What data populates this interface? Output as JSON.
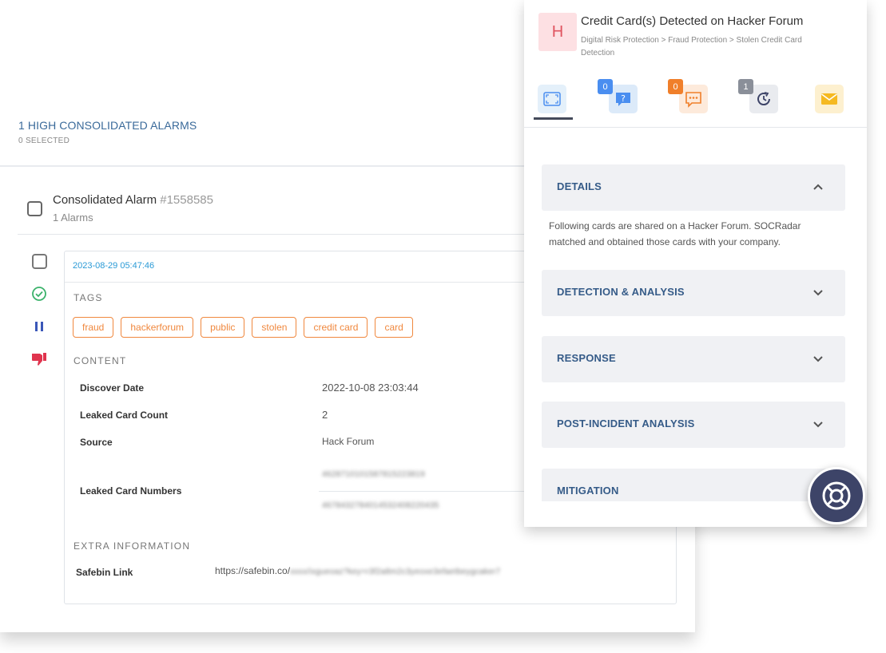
{
  "alarms": {
    "title": "1 HIGH CONSOLIDATED ALARMS",
    "selected": "0 SELECTED"
  },
  "consolidated": {
    "title": "Consolidated Alarm ",
    "id": "#1558585",
    "count": "1 Alarms"
  },
  "alarm_detail": {
    "date": "2023-08-29 05:47:46",
    "tags_label": "TAGS",
    "tags": [
      "fraud",
      "hackerforum",
      "public",
      "stolen",
      "credit card",
      "card"
    ],
    "content_label": "CONTENT",
    "fields": {
      "discover_date": {
        "label": "Discover Date",
        "value": "2022-10-08 23:03:44"
      },
      "leaked_card_count": {
        "label": "Leaked Card Count",
        "value": "2"
      },
      "source": {
        "label": "Source",
        "value": "Hack Forum"
      },
      "leaked_card_numbers": {
        "label": "Leaked Card Numbers",
        "values": [
          "4628710101587815223819",
          "4678432784014532408220435"
        ]
      }
    },
    "extra_label": "EXTRA INFORMATION",
    "safebin": {
      "label": "Safebin Link",
      "prefix": "https://safebin.co/",
      "blurred": "xxxx/ixgueoaz?key=r3f2a8m2c3yeoxe3efaetbeygcaker7"
    }
  },
  "panel": {
    "avatar_letter": "H",
    "title": "Credit Card(s) Detected on Hacker Forum",
    "breadcrumb": "Digital Risk Protection > Fraud Protection > Stolen Credit Card Detection",
    "tabs": [
      {
        "icon": "expand-icon",
        "badge": ""
      },
      {
        "icon": "question-icon",
        "badge": "0",
        "color": "#4a8ef0"
      },
      {
        "icon": "comment-icon",
        "badge": "0",
        "color": "#f07f2a"
      },
      {
        "icon": "history-icon",
        "badge": "1",
        "color": "#8a8f99"
      },
      {
        "icon": "mail-icon",
        "badge": ""
      }
    ],
    "sections": {
      "details": "DETAILS",
      "details_text": "Following cards are shared on a Hacker Forum. SOCRadar matched and obtained those cards with your company.",
      "detection": "DETECTION & ANALYSIS",
      "response": "RESPONSE",
      "post_incident": "POST-INCIDENT ANALYSIS",
      "mitigation": "MITIGATION"
    }
  },
  "colors": {
    "accent_blue": "#355b88",
    "tag_orange": "#f0883e",
    "date_blue": "#2a9ad6",
    "avatar_bg": "#fde0e3",
    "fab_bg": "#3d4468"
  }
}
